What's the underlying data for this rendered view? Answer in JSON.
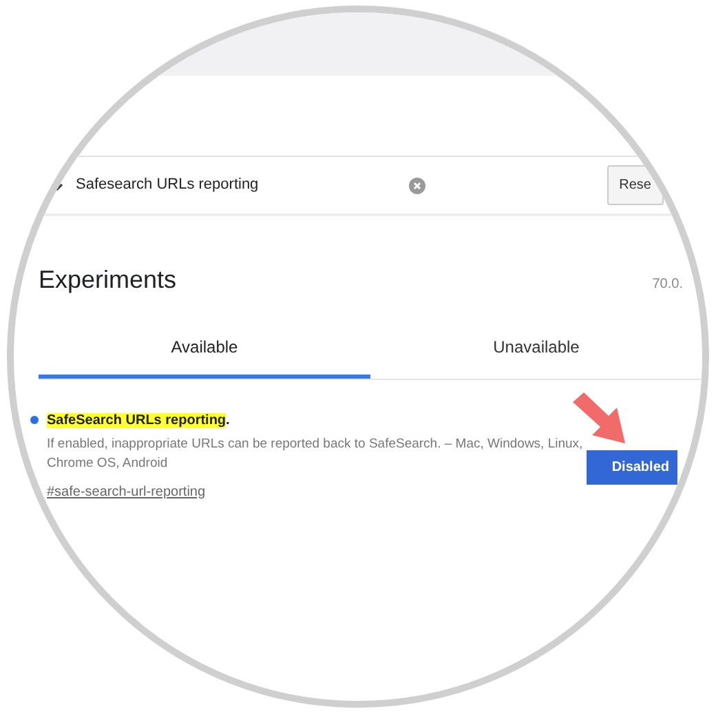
{
  "search": {
    "value": "Safesearch URLs reporting"
  },
  "reset_button": {
    "label": "Rese"
  },
  "heading": "Experiments",
  "version": "70.0.",
  "tabs": [
    {
      "label": "Available",
      "selected": true
    },
    {
      "label": "Unavailable",
      "selected": false
    }
  ],
  "flags": [
    {
      "title": {
        "text": "SafeSearch URLs reporting",
        "highlighted": true
      },
      "title_end": ".",
      "description": "If enabled, inappropriate URLs can be reported back to SafeSearch. – Mac, Windows, Linux, Chrome OS, Android",
      "link": "#safe-search-url-reporting",
      "state_button": "Disabled",
      "modified": true
    }
  ]
}
